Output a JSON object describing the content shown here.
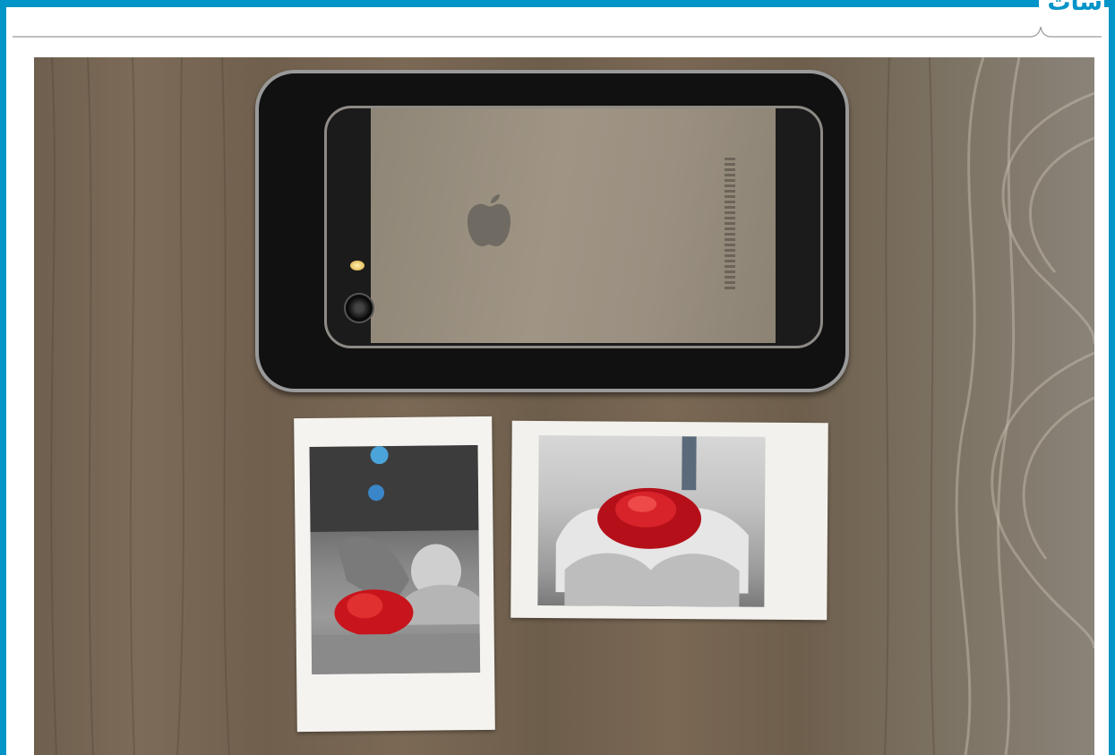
{
  "header": {
    "section_title": "سات",
    "accent_color": "#0094c8"
  },
  "photo": {
    "background": "wooden-table",
    "objects": [
      "iphone-in-printer-cradle",
      "instant-print-portrait",
      "instant-print-landscape"
    ],
    "highlight_color": "#c8141c"
  }
}
